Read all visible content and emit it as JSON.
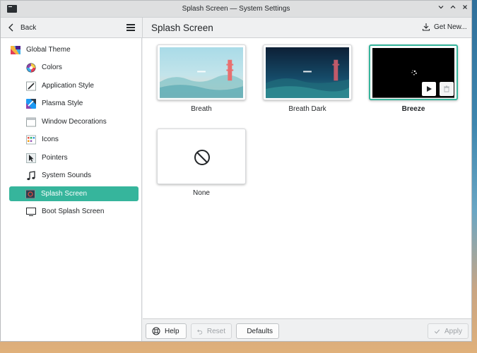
{
  "window": {
    "title": "Splash Screen — System Settings"
  },
  "titlebar_buttons": {
    "minimize_icon": "chevron-down-icon",
    "maximize_icon": "chevron-up-icon",
    "close_icon": "close-icon"
  },
  "header": {
    "back_label": "Back",
    "page_title": "Splash Screen",
    "get_new_label": "Get New..."
  },
  "sidebar": {
    "parent": "Global Theme",
    "items": [
      {
        "label": "Colors",
        "icon": "colors-icon"
      },
      {
        "label": "Application Style",
        "icon": "application-style-icon"
      },
      {
        "label": "Plasma Style",
        "icon": "plasma-style-icon"
      },
      {
        "label": "Window Decorations",
        "icon": "window-decorations-icon"
      },
      {
        "label": "Icons",
        "icon": "icons-icon"
      },
      {
        "label": "Pointers",
        "icon": "pointers-icon"
      },
      {
        "label": "System Sounds",
        "icon": "system-sounds-icon"
      },
      {
        "label": "Splash Screen",
        "icon": "splash-screen-icon",
        "selected": true
      },
      {
        "label": "Boot Splash Screen",
        "icon": "boot-splash-icon"
      }
    ]
  },
  "themes": [
    {
      "name": "Breath",
      "selected": false
    },
    {
      "name": "Breath Dark",
      "selected": false
    },
    {
      "name": "Breeze",
      "selected": true
    },
    {
      "name": "None",
      "selected": false
    }
  ],
  "footer": {
    "help": "Help",
    "reset": "Reset",
    "defaults": "Defaults",
    "apply": "Apply"
  },
  "colors": {
    "accent": "#36b59c",
    "selected_text": "#ffffff"
  }
}
